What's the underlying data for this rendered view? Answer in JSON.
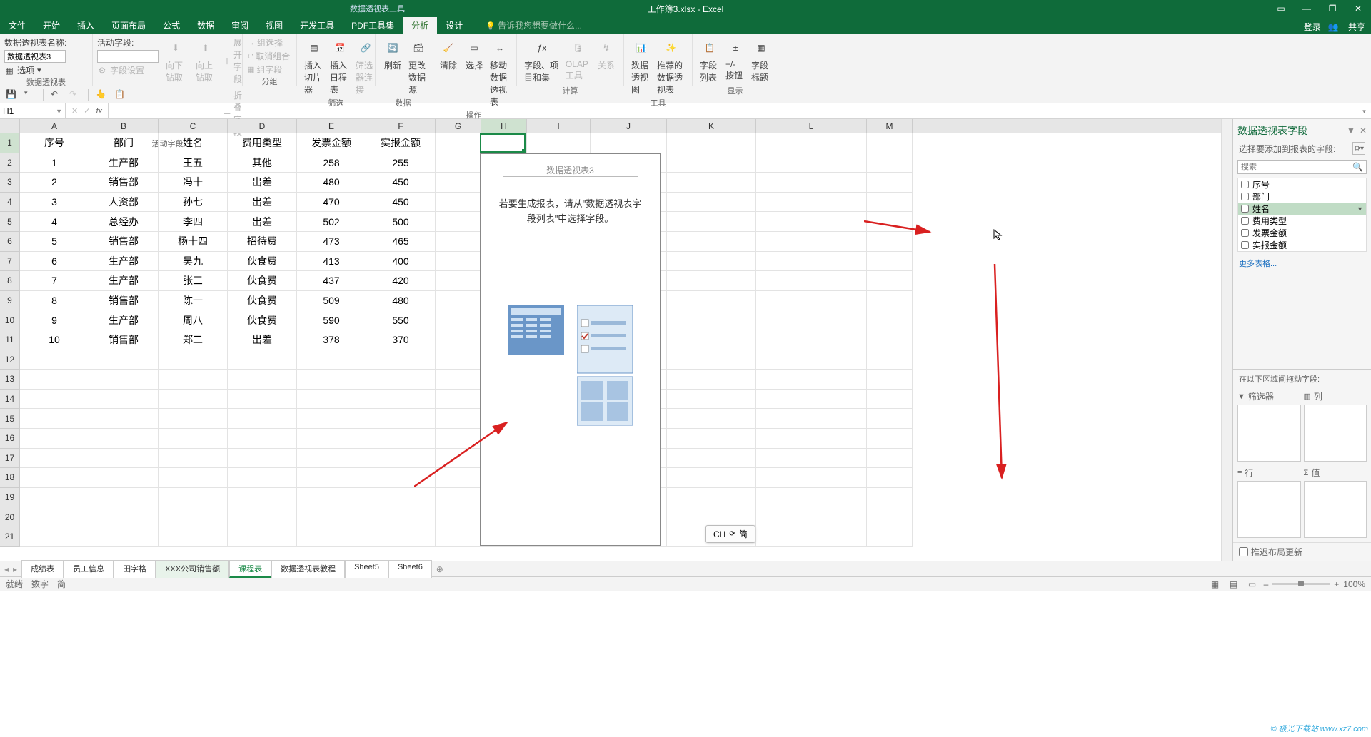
{
  "title": {
    "tool_context": "数据透视表工具",
    "document": "工作簿3.xlsx - Excel"
  },
  "window_controls": {
    "signin": "登录",
    "share": "共享"
  },
  "menu": {
    "tabs": [
      "文件",
      "开始",
      "插入",
      "页面布局",
      "公式",
      "数据",
      "审阅",
      "视图",
      "开发工具",
      "PDF工具集",
      "分析",
      "设计"
    ],
    "active_index": 10,
    "hint": "告诉我您想要做什么..."
  },
  "ribbon": {
    "groups": {
      "pivottable": {
        "label": "数据透视表",
        "name_label": "数据透视表名称:",
        "name_value": "数据透视表3",
        "options": "选项"
      },
      "activefield": {
        "label": "活动字段",
        "field_label": "活动字段:",
        "field_value": "",
        "settings": "字段设置",
        "drilldown": "向下钻取",
        "drillup": "向上钻取",
        "expand": "展开字段",
        "collapse": "折叠字段"
      },
      "group": {
        "label": "分组",
        "sel": "组选择",
        "ungroup": "取消组合",
        "field": "组字段"
      },
      "filter": {
        "label": "筛选",
        "slicer": "插入切片器",
        "timeline": "插入日程表",
        "conn": "筛选器连接"
      },
      "data": {
        "label": "数据",
        "refresh": "刷新",
        "change": "更改数据源"
      },
      "actions": {
        "label": "操作",
        "clear": "清除",
        "select": "选择",
        "move": "移动数据透视表"
      },
      "calc": {
        "label": "计算",
        "fields": "字段、项目和集",
        "olap": "OLAP 工具",
        "rel": "关系"
      },
      "tools": {
        "label": "工具",
        "chart": "数据透视图",
        "recommend": "推荐的数据透视表"
      },
      "show": {
        "label": "显示",
        "flist": "字段列表",
        "pm": "+/- 按钮",
        "hdr": "字段标题"
      }
    }
  },
  "namebox": "H1",
  "columns": [
    "A",
    "B",
    "C",
    "D",
    "E",
    "F",
    "G",
    "H",
    "I",
    "J",
    "K",
    "L",
    "M"
  ],
  "row_headers": [
    1,
    2,
    3,
    4,
    5,
    6,
    7,
    8,
    9,
    10,
    11,
    12,
    13,
    14,
    15,
    16,
    17,
    18,
    19,
    20,
    21
  ],
  "table": {
    "header": [
      "序号",
      "部门",
      "姓名",
      "费用类型",
      "发票金额",
      "实报金额"
    ],
    "rows": [
      [
        "1",
        "生产部",
        "王五",
        "其他",
        "258",
        "255"
      ],
      [
        "2",
        "销售部",
        "冯十",
        "出差",
        "480",
        "450"
      ],
      [
        "3",
        "人资部",
        "孙七",
        "出差",
        "470",
        "450"
      ],
      [
        "4",
        "总经办",
        "李四",
        "出差",
        "502",
        "500"
      ],
      [
        "5",
        "销售部",
        "杨十四",
        "招待费",
        "473",
        "465"
      ],
      [
        "6",
        "生产部",
        "吴九",
        "伙食费",
        "413",
        "400"
      ],
      [
        "7",
        "生产部",
        "张三",
        "伙食费",
        "437",
        "420"
      ],
      [
        "8",
        "销售部",
        "陈一",
        "伙食费",
        "509",
        "480"
      ],
      [
        "9",
        "生产部",
        "周八",
        "伙食费",
        "590",
        "550"
      ],
      [
        "10",
        "销售部",
        "郑二",
        "出差",
        "378",
        "370"
      ]
    ]
  },
  "pivot_placeholder": {
    "title": "数据透视表3",
    "text": "若要生成报表，请从\"数据透视表字段列表\"中选择字段。"
  },
  "fieldpane": {
    "title": "数据透视表字段",
    "subtitle": "选择要添加到报表的字段:",
    "search_placeholder": "搜索",
    "fields": [
      "序号",
      "部门",
      "姓名",
      "费用类型",
      "发票金额",
      "实报金额"
    ],
    "hover_index": 2,
    "more": "更多表格...",
    "areas_hint": "在以下区域间拖动字段:",
    "filters": "筛选器",
    "columns_lbl": "列",
    "rows_lbl": "行",
    "values_lbl": "值",
    "defer": "推迟布局更新"
  },
  "sheets": {
    "tabs": [
      "成绩表",
      "员工信息",
      "田字格",
      "XXX公司销售额",
      "课程表",
      "数据透视表教程",
      "Sheet5",
      "Sheet6"
    ],
    "active_index": 4,
    "selected_index": 3
  },
  "status": {
    "ready": "就绪",
    "num": "数字",
    "lang": "简",
    "zoom": "100%"
  },
  "ime": {
    "text": "CH",
    "sub": "简"
  },
  "watermark": "© 极光下载站 www.xz7.com"
}
